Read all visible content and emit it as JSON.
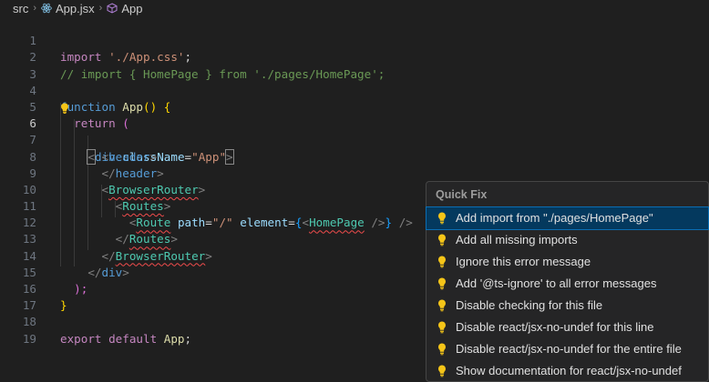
{
  "breadcrumb": {
    "items": [
      {
        "label": "src",
        "icon": ""
      },
      {
        "label": "App.jsx",
        "icon": "react-icon"
      },
      {
        "label": "App",
        "icon": "component-icon"
      }
    ]
  },
  "editor": {
    "active_line": 6,
    "lines": [
      {
        "n": "1"
      },
      {
        "n": "2"
      },
      {
        "n": "3"
      },
      {
        "n": "4"
      },
      {
        "n": "5"
      },
      {
        "n": "6"
      },
      {
        "n": "7"
      },
      {
        "n": "8"
      },
      {
        "n": "9"
      },
      {
        "n": "10"
      },
      {
        "n": "11"
      },
      {
        "n": "12"
      },
      {
        "n": "13"
      },
      {
        "n": "14"
      },
      {
        "n": "15"
      },
      {
        "n": "16"
      },
      {
        "n": "17"
      },
      {
        "n": "18"
      },
      {
        "n": "19"
      }
    ],
    "tokens": {
      "import_kw": "import",
      "import_str": "'./App.css'",
      "semi": ";",
      "comment2": "// import { HomePage } from './pages/HomePage';",
      "function_kw": "function",
      "app_name": "App",
      "parens": "()",
      "open_brace": "{",
      "return_kw": "return",
      "open_paren": "(",
      "lt": "<",
      "gt": ">",
      "lt_slash": "</",
      "slash_gt": "/>",
      "div": "div",
      "classname_attr": "className",
      "eq": "=",
      "app_str": "\"App\"",
      "header": "header",
      "browser_router": "BrowserRouter",
      "routes": "Routes",
      "route": "Route",
      "path_attr": "path",
      "path_str": "\"/\"",
      "element_attr": "element",
      "lbrace": "{",
      "rbrace": "}",
      "homepage": "HomePage",
      "close_paren": ");",
      "close_brace": "}",
      "export_kw": "export",
      "default_kw": "default",
      "app_ref": "App"
    }
  },
  "quick_fix": {
    "title": "Quick Fix",
    "items": [
      {
        "label": "Add import from \"./pages/HomePage\""
      },
      {
        "label": "Add all missing imports"
      },
      {
        "label": "Ignore this error message"
      },
      {
        "label": "Add '@ts-ignore' to all error messages"
      },
      {
        "label": "Disable checking for this file"
      },
      {
        "label": "Disable react/jsx-no-undef for this line"
      },
      {
        "label": "Disable react/jsx-no-undef for the entire file"
      },
      {
        "label": "Show documentation for react/jsx-no-undef"
      }
    ],
    "selected_index": 0
  },
  "colors": {
    "bulb": "#f5c518",
    "selection": "#04395e",
    "error_squiggle": "#f14c4c"
  }
}
